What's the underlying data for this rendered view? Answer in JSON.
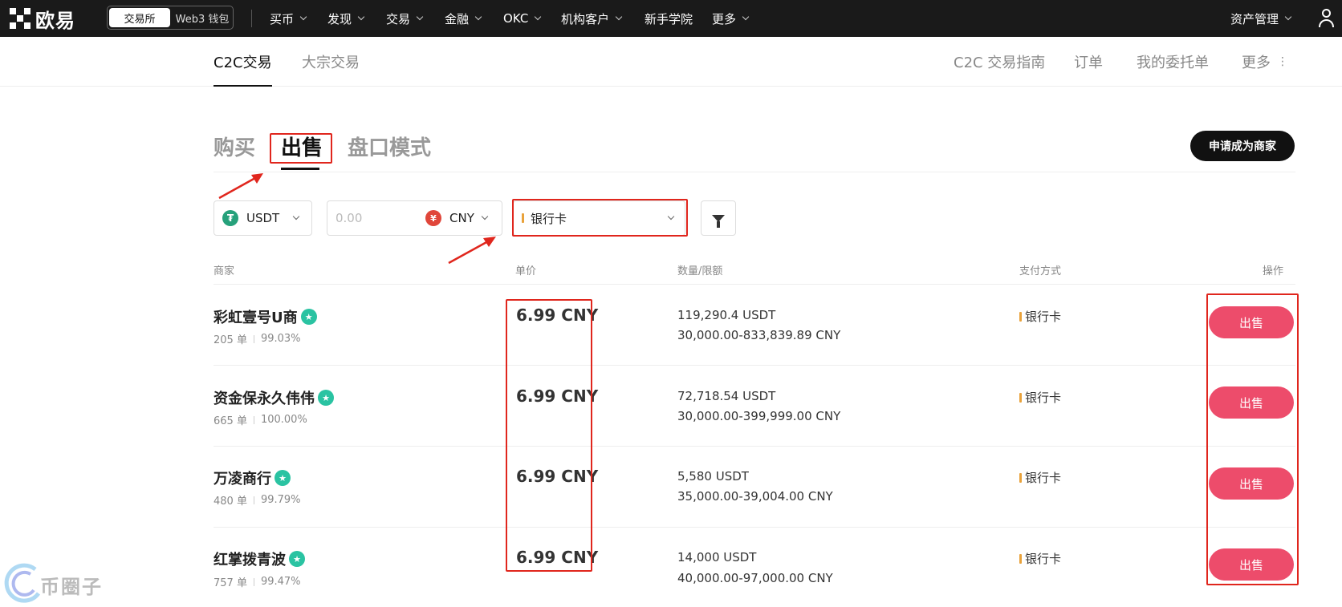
{
  "topnav": {
    "logo": "欧易",
    "switch": {
      "exchange": "交易所",
      "web3": "Web3 钱包"
    },
    "items": [
      "买币",
      "发现",
      "交易",
      "金融",
      "OKC",
      "机构客户",
      "新手学院",
      "更多"
    ],
    "assets": "资产管理"
  },
  "subnav": {
    "tabs": [
      "C2C交易",
      "大宗交易"
    ],
    "right": [
      "C2C 交易指南",
      "订单",
      "我的委托单",
      "更多"
    ]
  },
  "mode": {
    "tabs": [
      "购买",
      "出售",
      "盘口模式"
    ],
    "active": "出售",
    "merchant_button": "申请成为商家"
  },
  "filters": {
    "coin": "USDT",
    "amount_placeholder": "0.00",
    "currency": "CNY",
    "currency_symbol": "¥",
    "payment": "银行卡"
  },
  "table": {
    "headers": {
      "merchant": "商家",
      "price": "单价",
      "quantity": "数量/限额",
      "payment": "支付方式",
      "action": "操作"
    },
    "rows": [
      {
        "name": "彩虹壹号U商",
        "orders": "205 单",
        "rate": "99.03%",
        "price": "6.99 CNY",
        "qty": "119,290.4 USDT",
        "limit": "30,000.00-833,839.89 CNY",
        "payment": "银行卡",
        "action": "出售"
      },
      {
        "name": "资金保永久伟伟",
        "orders": "665 单",
        "rate": "100.00%",
        "price": "6.99 CNY",
        "qty": "72,718.54 USDT",
        "limit": "30,000.00-399,999.00 CNY",
        "payment": "银行卡",
        "action": "出售"
      },
      {
        "name": "万凌商行",
        "orders": "480 单",
        "rate": "99.79%",
        "price": "6.99 CNY",
        "qty": "5,580 USDT",
        "limit": "35,000.00-39,004.00 CNY",
        "payment": "银行卡",
        "action": "出售"
      },
      {
        "name": "红掌拨青波",
        "orders": "757 单",
        "rate": "99.47%",
        "price": "6.99 CNY",
        "qty": "14,000 USDT",
        "limit": "40,000.00-97,000.00 CNY",
        "payment": "银行卡",
        "action": "出售"
      }
    ]
  },
  "watermark": "币圈子",
  "colors": {
    "accent_sell": "#ed4c6b",
    "annotation": "#e0261d",
    "tether": "#26a17b",
    "cny": "#e0463a",
    "badge": "#2ac3a2"
  }
}
